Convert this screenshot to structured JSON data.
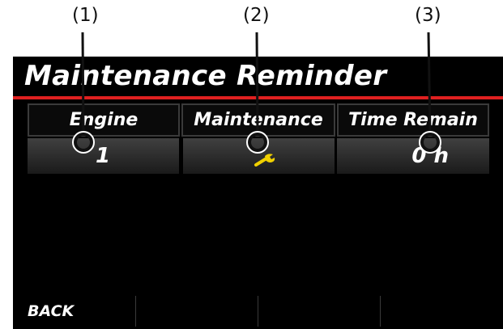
{
  "callouts": [
    "(1)",
    "(2)",
    "(3)"
  ],
  "title": "Maintenance Reminder",
  "table": {
    "headers": [
      "Engine",
      "Maintenance",
      "Time Remain"
    ],
    "row": {
      "engine": "1",
      "maintenance_icon": "wrench-icon",
      "time_remain": "0 h"
    }
  },
  "softkeys": {
    "back": "BACK",
    "key2": "",
    "key3": "",
    "key4": ""
  },
  "colors": {
    "screen_bg": "#000000",
    "title_rule": "#e02020",
    "wrench": "#f0d000",
    "text": "#ffffff"
  }
}
